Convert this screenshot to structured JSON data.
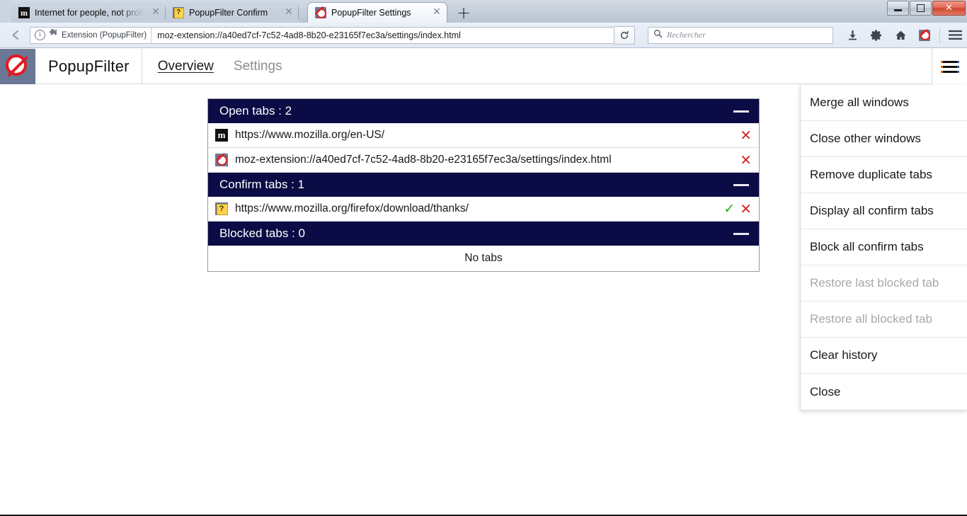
{
  "window": {
    "controls": {
      "minimize": "minimize",
      "maximize": "restore",
      "close": "✕"
    }
  },
  "browser": {
    "tabs": [
      {
        "title": "Internet for people, not profit",
        "favicon": "mozilla-icon",
        "active": false,
        "close_label": "✕"
      },
      {
        "title": "PopupFilter Confirm",
        "favicon": "help-icon",
        "active": false,
        "close_label": "✕"
      },
      {
        "title": "PopupFilter Settings",
        "favicon": "popupfilter-icon",
        "active": true,
        "close_label": "✕"
      }
    ],
    "new_tab_label": "+",
    "back_label": "←",
    "identity_label": "Extension (PopupFilter)",
    "url": "moz-extension://a40ed7cf-7c52-4ad8-8b20-e23165f7ec3a/settings/index.html",
    "reload_label": "⟳",
    "search_placeholder": "Rechercher",
    "toolbar_icons": [
      "downloads-icon",
      "gear-icon",
      "home-icon",
      "popupfilter-icon",
      "hamburger-icon"
    ]
  },
  "extension": {
    "brand": "PopupFilter",
    "nav": [
      {
        "label": "Overview",
        "active": true
      },
      {
        "label": "Settings",
        "active": false
      }
    ],
    "menu_button": "hamburger-icon"
  },
  "groups": [
    {
      "title": "Open tabs : 2",
      "collapse_label": "—",
      "empty_text": null,
      "rows": [
        {
          "favicon": "mozilla-icon",
          "url": "https://www.mozilla.org/en-US/",
          "confirm": false,
          "close_label": "✕",
          "check_label": "✓"
        },
        {
          "favicon": "popupfilter-icon",
          "url": "moz-extension://a40ed7cf-7c52-4ad8-8b20-e23165f7ec3a/settings/index.html",
          "confirm": false,
          "close_label": "✕",
          "check_label": "✓"
        }
      ]
    },
    {
      "title": "Confirm tabs : 1",
      "collapse_label": "—",
      "empty_text": null,
      "rows": [
        {
          "favicon": "help-icon",
          "url": "https://www.mozilla.org/firefox/download/thanks/",
          "confirm": true,
          "close_label": "✕",
          "check_label": "✓"
        }
      ]
    },
    {
      "title": "Blocked tabs : 0",
      "collapse_label": "—",
      "empty_text": "No tabs",
      "rows": []
    }
  ],
  "menu": {
    "items": [
      {
        "label": "Merge all windows",
        "disabled": false
      },
      {
        "label": "Close other windows",
        "disabled": false
      },
      {
        "label": "Remove duplicate tabs",
        "disabled": false
      },
      {
        "label": "Display all confirm tabs",
        "disabled": false
      },
      {
        "label": "Block all confirm tabs",
        "disabled": false
      },
      {
        "label": "Restore last blocked tab",
        "disabled": true
      },
      {
        "label": "Restore all blocked tab",
        "disabled": true
      },
      {
        "label": "Clear history",
        "disabled": false
      },
      {
        "label": "Close",
        "disabled": false
      }
    ]
  },
  "colors": {
    "group_header_bg": "#0b0b45",
    "accent_red": "#d02a2a",
    "accent_green": "#19b014",
    "brand_red": "#e01b22"
  }
}
